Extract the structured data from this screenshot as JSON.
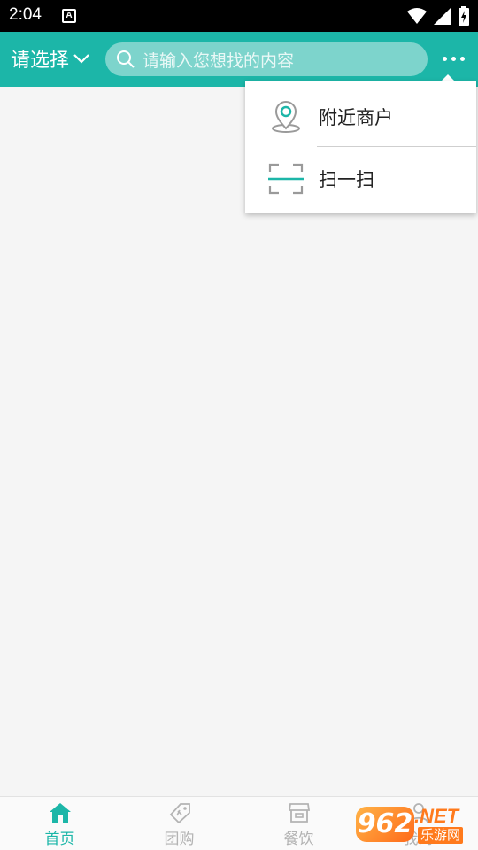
{
  "status_bar": {
    "time": "2:04",
    "notif_letter": "A"
  },
  "header": {
    "city_select_label": "请选择",
    "search_placeholder": "请输入您想找的内容"
  },
  "popup_menu": {
    "items": [
      {
        "label": "附近商户",
        "icon": "location-pin-icon"
      },
      {
        "label": "扫一扫",
        "icon": "scan-icon"
      }
    ]
  },
  "tabbar": {
    "tabs": [
      {
        "label": "首页",
        "icon": "home-icon",
        "active": true
      },
      {
        "label": "团购",
        "icon": "coupon-tag-icon",
        "active": false
      },
      {
        "label": "餐饮",
        "icon": "shop-icon",
        "active": false
      },
      {
        "label": "我的",
        "icon": "person-icon",
        "active": false
      }
    ]
  },
  "watermark": {
    "number": "962",
    "suffix": ".NET",
    "site_name": "乐游网"
  },
  "colors": {
    "accent": "#1cb6a8",
    "inactive": "#b3b3b3",
    "background": "#f5f5f5"
  }
}
